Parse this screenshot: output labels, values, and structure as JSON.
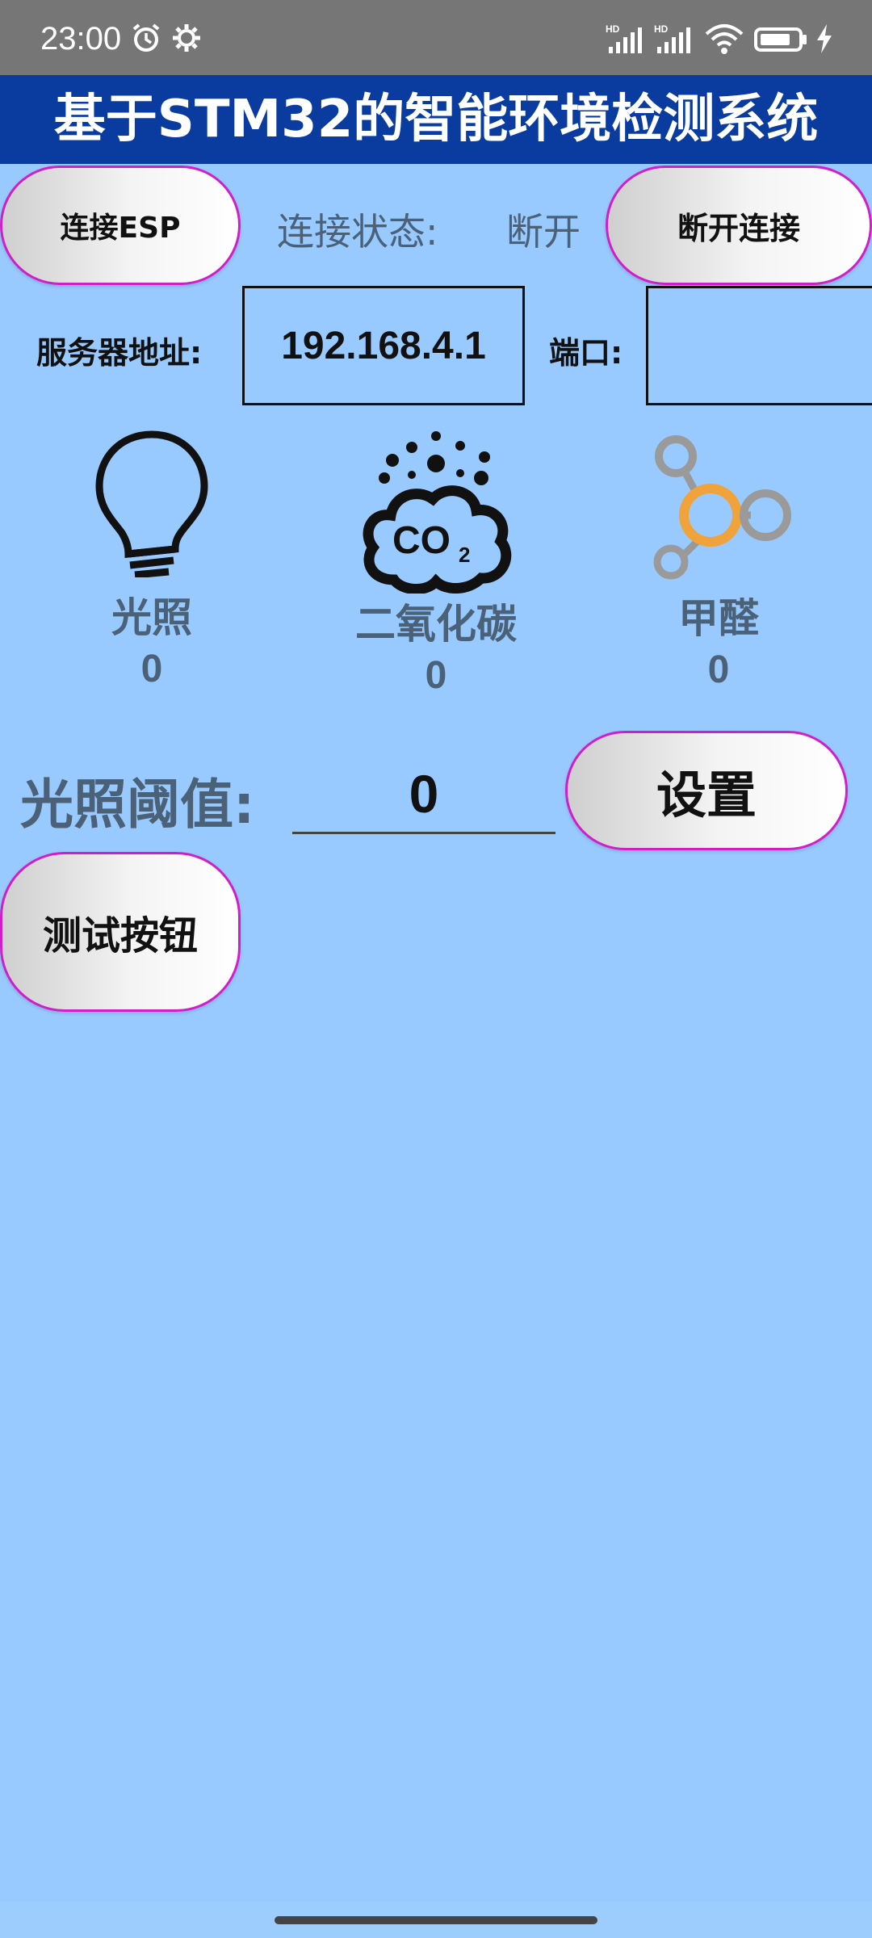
{
  "status_bar": {
    "time": "23:00",
    "icons": [
      "alarm-icon",
      "settings-gear-icon",
      "hd-signal-icon",
      "hd-signal-icon",
      "wifi-icon",
      "battery-icon",
      "charging-icon"
    ]
  },
  "app": {
    "title": "基于STM32的智能环境检测系统"
  },
  "connection": {
    "connect_button": "连接ESP",
    "status_label": "连接状态:",
    "status_value": "断开",
    "disconnect_button": "断开连接"
  },
  "server": {
    "address_label": "服务器地址:",
    "address_value": "192.168.4.1",
    "port_label": "端口:",
    "port_value": ""
  },
  "sensors": [
    {
      "name": "光照",
      "value": "0",
      "icon": "lightbulb-icon"
    },
    {
      "name": "二氧化碳",
      "value": "0",
      "icon": "co2-cloud-icon"
    },
    {
      "name": "甲醛",
      "value": "0",
      "icon": "molecule-icon"
    }
  ],
  "threshold": {
    "label": "光照阈值:",
    "value": "0",
    "set_button": "设置"
  },
  "test": {
    "button": "测试按钮"
  },
  "colors": {
    "background": "#99caff",
    "title_bar": "#0a3ca0",
    "button_border": "#d11fc8",
    "label_text": "#4a6178"
  }
}
